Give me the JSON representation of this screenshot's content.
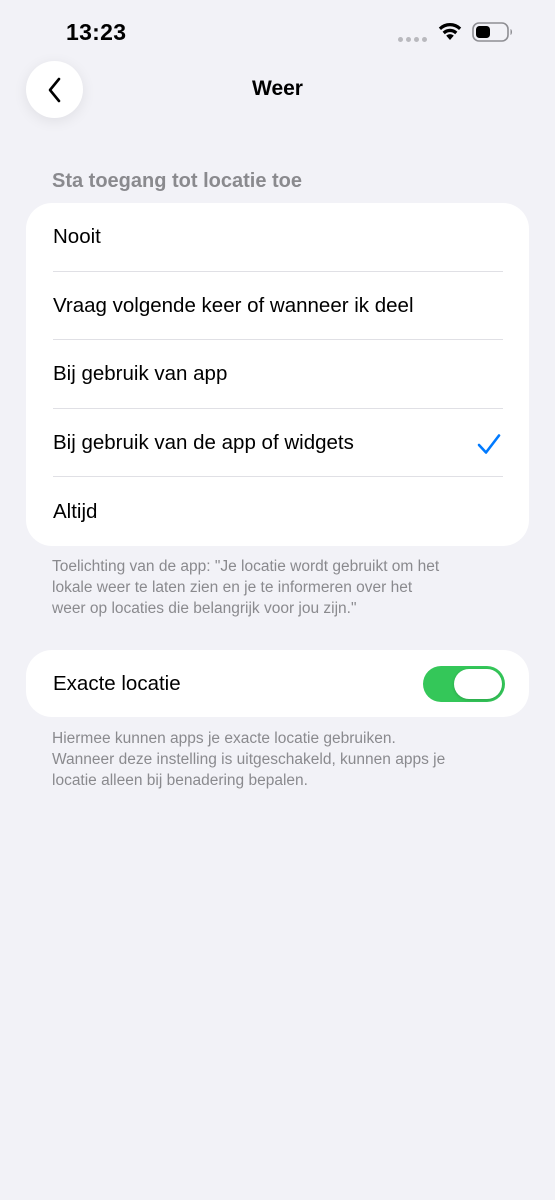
{
  "status_bar": {
    "time": "13:23",
    "icons": [
      "signal-dots-icon",
      "wifi-icon",
      "battery-icon"
    ]
  },
  "nav": {
    "back_icon": "chevron-left-icon",
    "title": "Weer"
  },
  "location_access": {
    "header": "Sta toegang tot locatie toe",
    "options": [
      {
        "label": "Nooit",
        "selected": false
      },
      {
        "label": "Vraag volgende keer of wanneer ik deel",
        "selected": false
      },
      {
        "label": "Bij gebruik van app",
        "selected": false
      },
      {
        "label": "Bij gebruik van de app of widgets",
        "selected": true
      },
      {
        "label": "Altijd",
        "selected": false
      }
    ],
    "footer_line1": "Toelichting van de app: \"Je locatie wordt gebruikt om het",
    "footer_line2": "lokale weer te laten zien en je te informeren over het",
    "footer_line3": "weer op locaties die belangrijk voor jou zijn.\""
  },
  "exact_location": {
    "label": "Exacte locatie",
    "enabled": true,
    "footer_line1": "Hiermee kunnen apps je exacte locatie gebruiken.",
    "footer_line2": "Wanneer deze instelling is uitgeschakeld, kunnen apps je",
    "footer_line3": "locatie alleen bij benadering bepalen."
  },
  "colors": {
    "background": "#f2f2f7",
    "accent": "#007aff",
    "toggle_on": "#34c759",
    "secondary_text": "#8a8a8e"
  }
}
